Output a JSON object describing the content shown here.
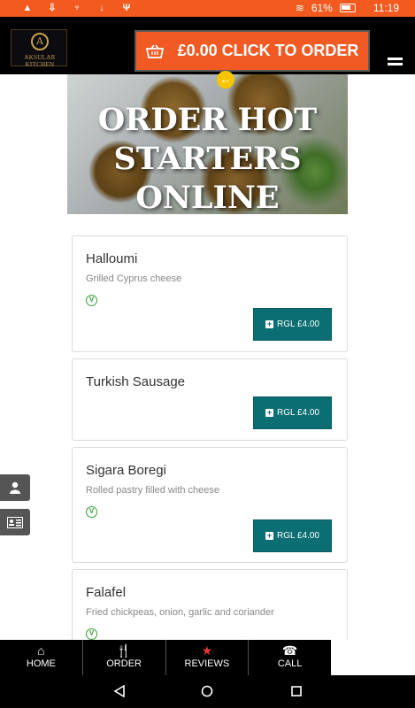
{
  "statusbar": {
    "battery": "61%",
    "time": "11:19"
  },
  "header": {
    "logo_text": "AKSULAR KITCHEN",
    "logo_mark": "A",
    "order_label": "£0.00 CLICK TO ORDER"
  },
  "hero": {
    "title_line1": "ORDER HOT STARTERS",
    "title_line2": "ONLINE",
    "back_icon": "arrow-left-icon"
  },
  "items": [
    {
      "name": "Halloumi",
      "desc": "Grilled Cyprus cheese",
      "veg": "V",
      "price": "RGL £4.00"
    },
    {
      "name": "Turkish Sausage",
      "desc": "",
      "veg": "",
      "price": "RGL £4.00"
    },
    {
      "name": "Sigara Boregi",
      "desc": "Rolled pastry filled with cheese",
      "veg": "V",
      "price": "RGL £4.00"
    },
    {
      "name": "Falafel",
      "desc": "Fried chickpeas, onion, garlic and coriander",
      "veg": "V",
      "price": ""
    }
  ],
  "bottom_nav": [
    {
      "label": "HOME",
      "icon": "home-icon"
    },
    {
      "label": "ORDER",
      "icon": "utensils-icon"
    },
    {
      "label": "REVIEWS",
      "icon": "star-icon"
    },
    {
      "label": "CALL",
      "icon": "phone-icon"
    }
  ],
  "colors": {
    "accent": "#f25a24",
    "button": "#0b6e73",
    "star": "#e53935",
    "veg": "#37a037"
  }
}
